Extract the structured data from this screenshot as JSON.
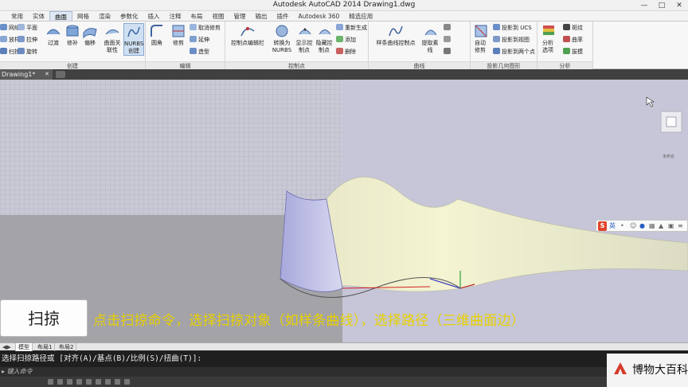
{
  "window": {
    "title": "Autodesk AutoCAD 2014    Drawing1.dwg"
  },
  "ribbon_tabs": [
    "常用",
    "实体",
    "曲面",
    "网格",
    "渲染",
    "参数化",
    "插入",
    "注释",
    "布局",
    "视图",
    "管理",
    "输出",
    "插件",
    "Autodesk 360",
    "精选应用"
  ],
  "active_tab": "曲面",
  "panels": {
    "create": {
      "label": "创建",
      "small_left": [
        "网络",
        "放样",
        "扫掠"
      ],
      "small_mid": [
        "平面",
        "拉伸",
        "旋转"
      ],
      "big": [
        "过渡",
        "修补",
        "偏移",
        "曲面关联性",
        "NURBS创建"
      ]
    },
    "edit": {
      "label": "编辑",
      "big": [
        "圆角",
        "修剪"
      ],
      "small": [
        "取消修剪",
        "延伸",
        "造型"
      ]
    },
    "cv": {
      "label": "控制点",
      "big": [
        "控制点编辑栏",
        "转换为NURBS",
        "显示控制点",
        "隐藏控制点"
      ],
      "small": [
        "重新生成",
        "添加",
        "删除"
      ]
    },
    "curves": {
      "label": "曲线",
      "big": [
        "样条曲线控制点",
        "提取素线"
      ]
    },
    "projection": {
      "label": "投影几何图形",
      "big": [
        "自动修剪"
      ],
      "small": [
        "投影到 UCS",
        "投影到视图",
        "投影到两个点"
      ]
    },
    "analysis": {
      "label": "分析",
      "big": [
        "分析选项"
      ],
      "small": [
        "斑纹",
        "曲率",
        "拔模"
      ]
    }
  },
  "document_tab": "Drawing1*",
  "viewcube_label": "未命名",
  "layout_tabs": [
    "模型",
    "布局1",
    "布局2"
  ],
  "command": {
    "prompt": "选择扫掠路径或 [对齐(A)/基点(B)/比例(S)/扭曲(T)]:",
    "input_placeholder": "键入命令"
  },
  "subtitle": {
    "command_name": "扫掠",
    "caption": "点击扫掠命令，选择扫掠对象（如样条曲线），选择路径（三维曲面边）"
  },
  "ime": {
    "logo": "S",
    "mode": "英"
  },
  "watermark": "博物大百科",
  "colors": {
    "caption": "#e8d000",
    "surface": "#f0f0c8",
    "sweep_profile": "#b8b8e8",
    "ribbon_active": "#dfe8f3"
  }
}
